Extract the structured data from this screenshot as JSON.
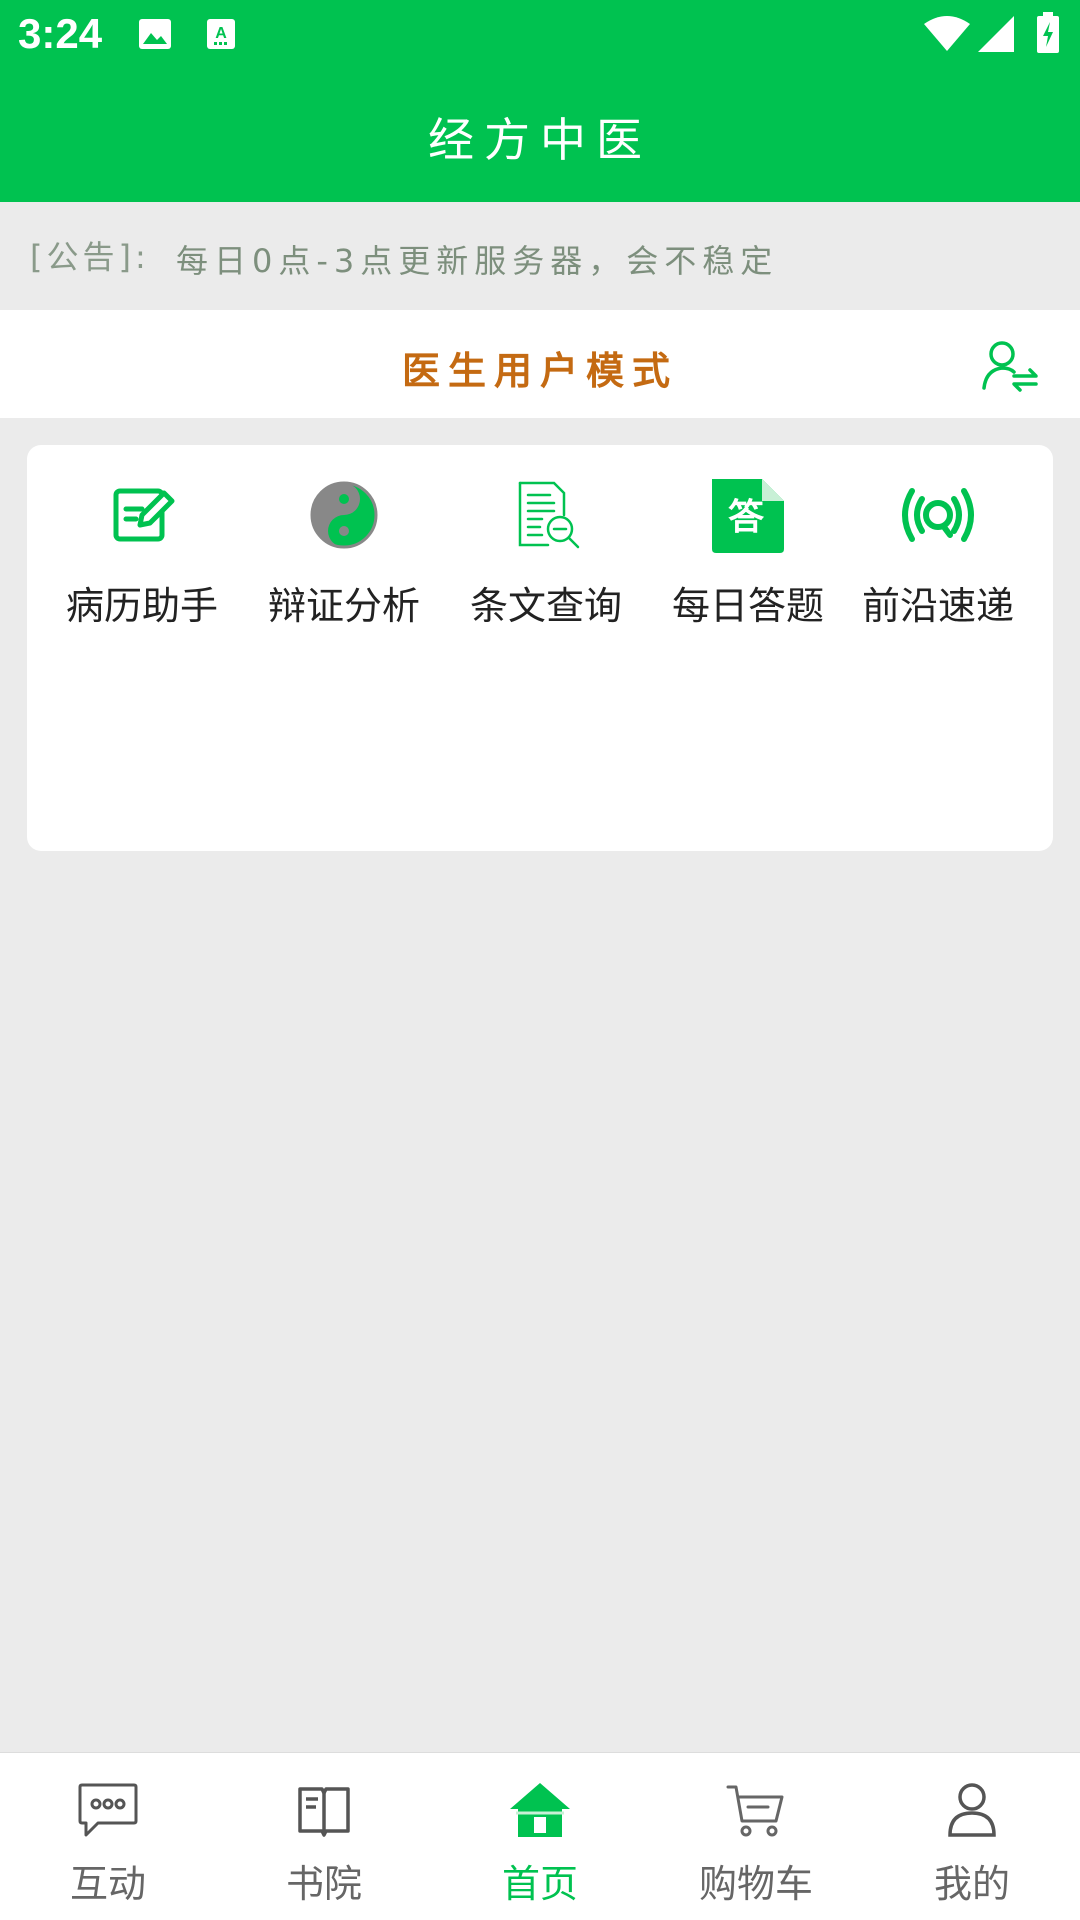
{
  "status_bar": {
    "time": "3:24",
    "icons": [
      "image-icon",
      "text-icon",
      "wifi-icon",
      "signal-icon",
      "battery-icon"
    ]
  },
  "app_bar": {
    "title": "经方中医"
  },
  "notice": {
    "prefix": "[公告]:",
    "text": "每日0点-3点更新服务器，会不稳定"
  },
  "mode_bar": {
    "title": "医生用户模式",
    "switch_icon": "user-switch-icon"
  },
  "features": [
    {
      "label": "病历助手",
      "icon": "edit-note-icon"
    },
    {
      "label": "辩证分析",
      "icon": "yin-yang-icon"
    },
    {
      "label": "条文查询",
      "icon": "document-search-icon"
    },
    {
      "label": "每日答题",
      "icon": "answer-doc-icon",
      "icon_text": "答"
    },
    {
      "label": "前沿速递",
      "icon": "broadcast-icon"
    }
  ],
  "bottom_nav": {
    "items": [
      {
        "label": "互动",
        "icon": "chat-bubble-icon",
        "active": false
      },
      {
        "label": "书院",
        "icon": "book-icon",
        "active": false
      },
      {
        "label": "首页",
        "icon": "home-icon",
        "active": true
      },
      {
        "label": "购物车",
        "icon": "cart-icon",
        "active": false
      },
      {
        "label": "我的",
        "icon": "person-icon",
        "active": false
      }
    ]
  },
  "colors": {
    "brand_green": "#00C250",
    "mode_orange": "#C46A12",
    "notice_text": "#7D8F7D",
    "background": "#EBEBEB"
  }
}
